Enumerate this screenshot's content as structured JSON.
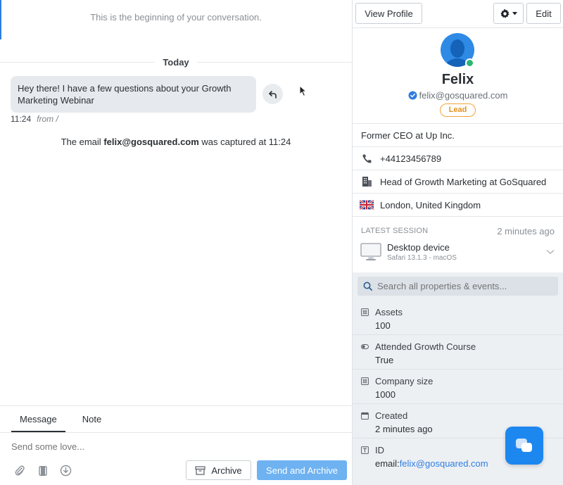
{
  "conversation": {
    "beginning_text": "This is the beginning of your conversation.",
    "day_label": "Today",
    "message": {
      "text": "Hey there! I have a few questions about your Growth Marketing Webinar",
      "time": "11:24",
      "from": "from /"
    },
    "captured": {
      "prefix": "The email ",
      "email": "felix@gosquared.com",
      "suffix": " was captured at 11:24"
    }
  },
  "composer": {
    "tabs": [
      {
        "label": "Message"
      },
      {
        "label": "Note"
      }
    ],
    "placeholder": "Send some love...",
    "archive_label": "Archive",
    "send_archive_label": "Send and Archive"
  },
  "profile_panel": {
    "view_profile_label": "View Profile",
    "edit_label": "Edit",
    "name": "Felix",
    "email": "felix@gosquared.com",
    "badge": "Lead",
    "bio": "Former CEO at Up Inc.",
    "phone": "+44123456789",
    "company": "Head of Growth Marketing at GoSquared",
    "location": "London, United Kingdom",
    "session": {
      "heading": "LATEST SESSION",
      "time": "2 minutes ago",
      "device": "Desktop device",
      "browser": "Safari 13.1.3 - macOS"
    },
    "search_placeholder": "Search all properties & events...",
    "properties": [
      {
        "name": "Assets",
        "value": "100",
        "icon": "hash-icon"
      },
      {
        "name": "Attended Growth Course",
        "value": "True",
        "icon": "toggle-icon"
      },
      {
        "name": "Company size",
        "value": "1000",
        "icon": "hash-icon"
      },
      {
        "name": "Created",
        "value": "2 minutes ago",
        "icon": "calendar-icon"
      },
      {
        "name": "ID",
        "value_prefix": "email:",
        "value_link": "felix@gosquared.com",
        "icon": "text-icon"
      }
    ]
  },
  "colors": {
    "accent": "#2f7de1",
    "send_button": "#6eb2f2",
    "lead_badge": "#e3921f",
    "online": "#2bb673",
    "chat_fab": "#1d87f0"
  }
}
